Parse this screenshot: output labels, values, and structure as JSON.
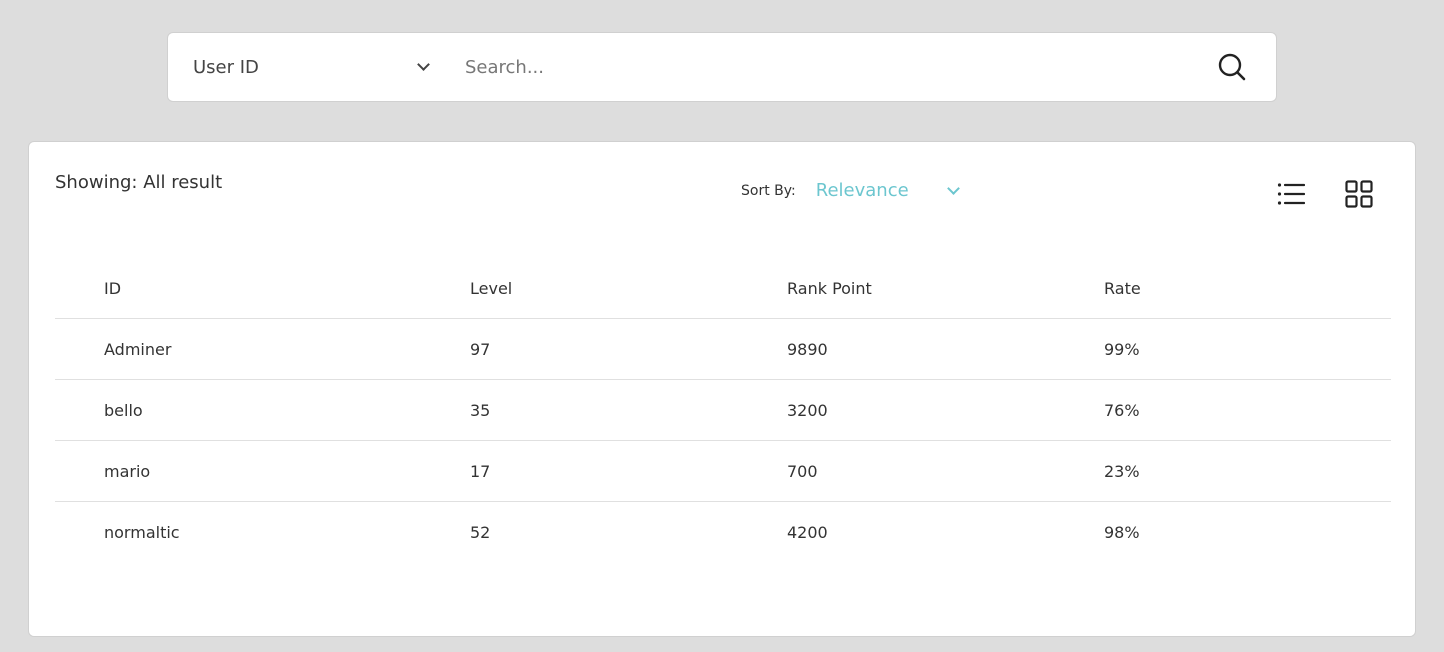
{
  "search": {
    "field_select": "User ID",
    "placeholder": "Search..."
  },
  "results": {
    "showing_text": "Showing: All result",
    "sort_label": "Sort By:",
    "sort_value": "Relevance",
    "columns": [
      "ID",
      "Level",
      "Rank Point",
      "Rate"
    ],
    "rows": [
      [
        "Adminer",
        "97",
        "9890",
        "99%"
      ],
      [
        "bello",
        "35",
        "3200",
        "76%"
      ],
      [
        "mario",
        "17",
        "700",
        "23%"
      ],
      [
        "normaltic",
        "52",
        "4200",
        "98%"
      ]
    ]
  },
  "icons": {
    "search": "search-icon",
    "chevron": "chevron-down-icon",
    "list_view": "list-view-icon",
    "grid_view": "grid-view-icon"
  },
  "colors": {
    "background": "#dddddd",
    "accent": "#6cc6cf",
    "text": "#333333"
  }
}
